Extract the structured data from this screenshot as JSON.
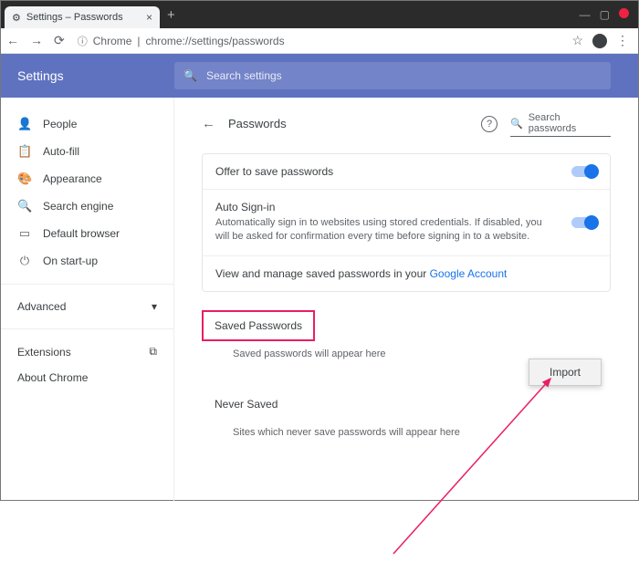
{
  "window": {
    "tab_title": "Settings – Passwords"
  },
  "toolbar": {
    "chrome_label": "Chrome",
    "url": "chrome://settings/passwords"
  },
  "header": {
    "brand": "Settings",
    "search_placeholder": "Search settings"
  },
  "sidebar": {
    "items": [
      {
        "label": "People"
      },
      {
        "label": "Auto-fill"
      },
      {
        "label": "Appearance"
      },
      {
        "label": "Search engine"
      },
      {
        "label": "Default browser"
      },
      {
        "label": "On start-up"
      }
    ],
    "advanced": "Advanced",
    "extensions": "Extensions",
    "about": "About Chrome"
  },
  "page": {
    "title": "Passwords",
    "search_placeholder": "Search passwords",
    "offer": "Offer to save passwords",
    "autosignin_title": "Auto Sign-in",
    "autosignin_desc": "Automatically sign in to websites using stored credentials. If disabled, you will be asked for confirmation every time before signing in to a website.",
    "manage_text": "View and manage saved passwords in your ",
    "manage_link": "Google Account",
    "saved_title": "Saved Passwords",
    "saved_empty": "Saved passwords will appear here",
    "never_title": "Never Saved",
    "never_empty": "Sites which never save passwords will appear here",
    "popup": "Import"
  }
}
